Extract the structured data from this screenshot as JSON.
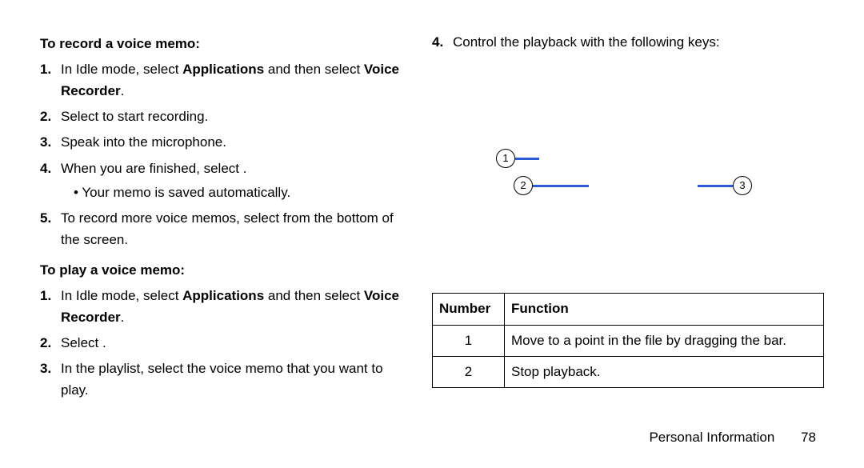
{
  "left": {
    "heading_record": "To record a voice memo:",
    "record_steps": {
      "s1": {
        "num": "1.",
        "a": "In Idle mode, select ",
        "b": "Applications",
        "c": " and then select ",
        "d": "Voice Recorder",
        "e": "."
      },
      "s2": {
        "num": "2.",
        "a": "Select ",
        "gap": "      ",
        "b": " to start recording."
      },
      "s3": {
        "num": "3.",
        "a": "Speak into the microphone."
      },
      "s4": {
        "num": "4.",
        "a": "When you are finished, select ",
        "gap": "    ",
        "b": ".",
        "sub": "Your memo is saved automatically."
      },
      "s5": {
        "num": "5.",
        "a": "To record more voice memos, select ",
        "gap": "    ",
        "b": " from the bottom of the screen."
      }
    },
    "heading_play": "To play a voice memo:",
    "play_steps": {
      "s1": {
        "num": "1.",
        "a": "In Idle mode, select ",
        "b": "Applications",
        "c": " and then select ",
        "d": "Voice Recorder",
        "e": "."
      },
      "s2": {
        "num": "2.",
        "a": "Select ",
        "gap": "    ",
        "b": "."
      },
      "s3": {
        "num": "3.",
        "a": "In the playlist, select the voice memo that you want to play."
      }
    }
  },
  "right": {
    "step4": {
      "num": "4.",
      "text": "Control the playback with the following keys:"
    },
    "callouts": {
      "c1": "1",
      "c2": "2",
      "c3": "3"
    },
    "table": {
      "head_num": "Number",
      "head_func": "Function",
      "r1_num": "1",
      "r1_func": "Move to a point in the file by dragging the bar.",
      "r2_num": "2",
      "r2_func": "Stop playback."
    }
  },
  "footer": {
    "section": "Personal Information",
    "page": "78"
  }
}
